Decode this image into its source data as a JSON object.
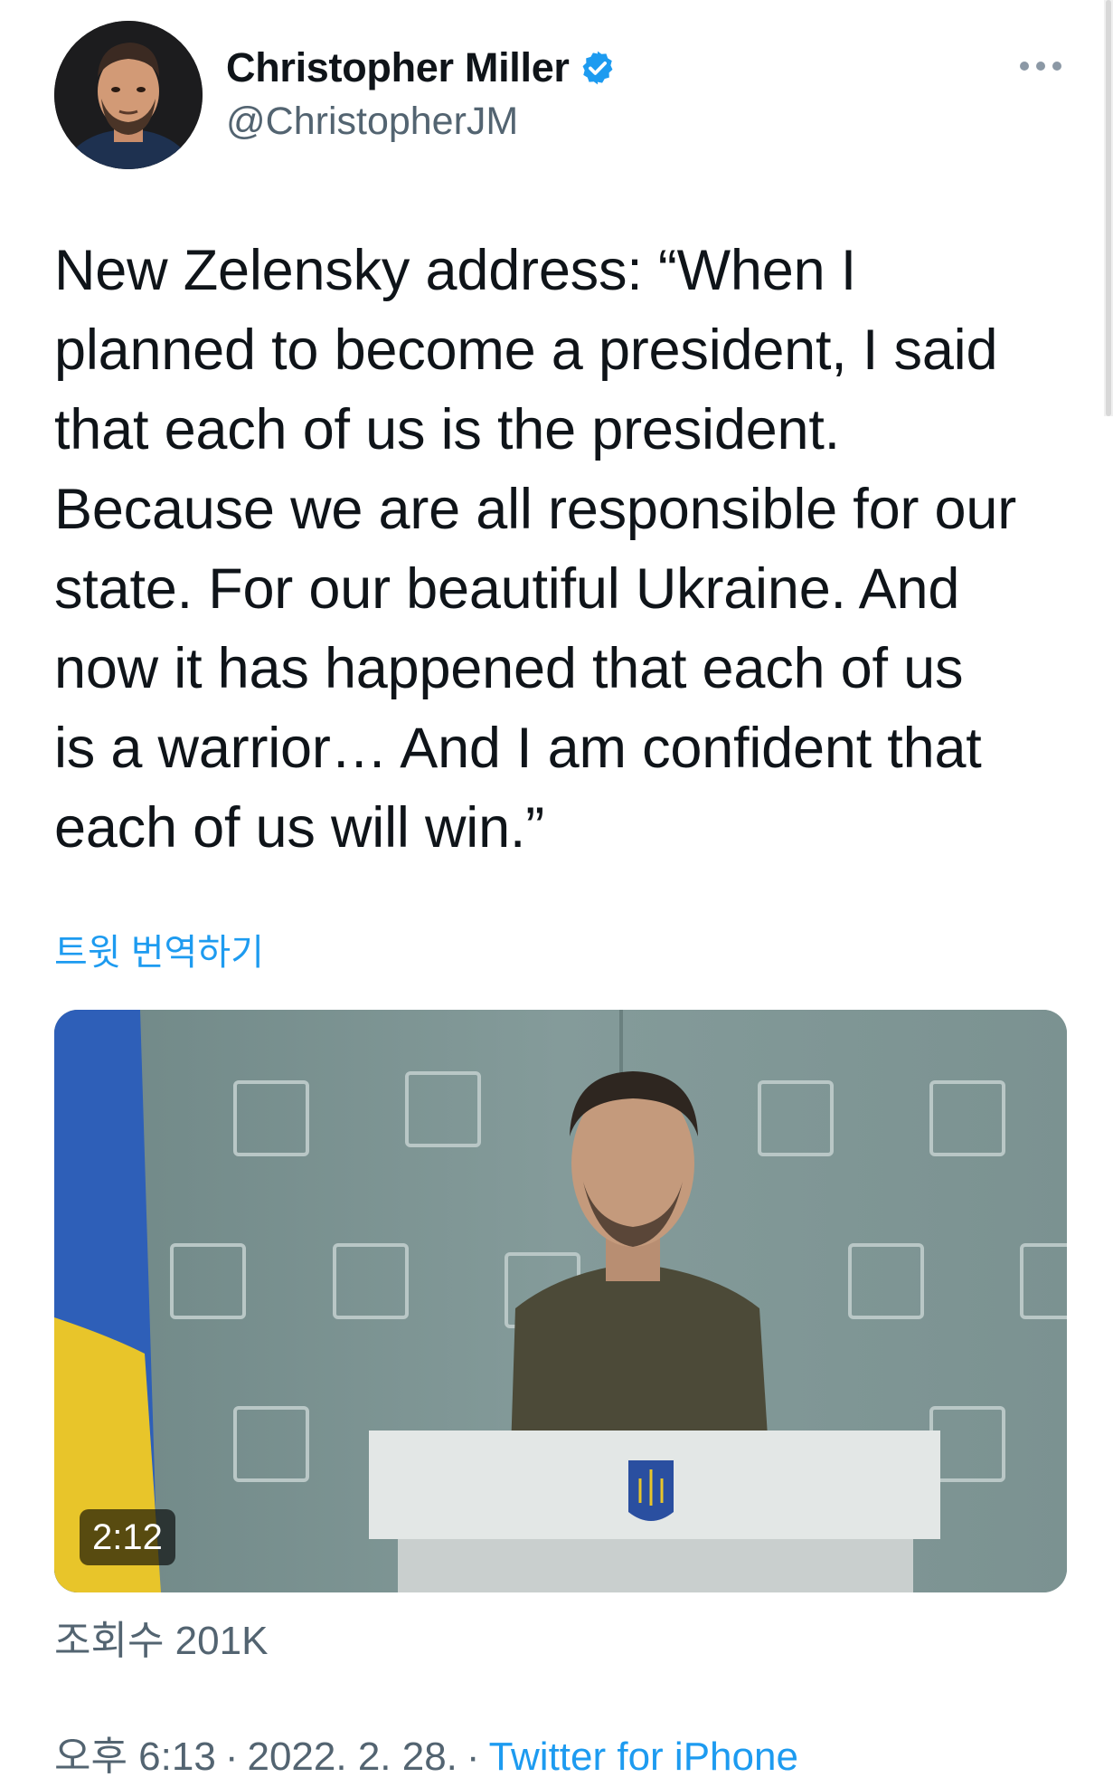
{
  "author": {
    "display_name": "Christopher Miller",
    "handle": "@ChristopherJM",
    "verified": true,
    "avatar_icon": "profile-photo"
  },
  "menu": {
    "more_icon": "more-horizontal-icon"
  },
  "tweet": {
    "text": "New Zelensky address: “When I\nplanned to become a president, I said\nthat each of us is the president.\nBecause we are all responsible for our\nstate. For our beautiful Ukraine. And\nnow it has happened that each of us\nis a warrior… And I am confident that\neach of us will win.”",
    "translate_label": "트윗 번역하기"
  },
  "media": {
    "type": "video",
    "duration": "2:12"
  },
  "stats": {
    "views": "조회수 201K"
  },
  "meta": {
    "time": "오후 6:13",
    "separator": "·",
    "date": "2022. 2. 28.",
    "source": "Twitter for iPhone"
  },
  "colors": {
    "link": "#1d9bf0",
    "secondary_text": "#536471",
    "verified": "#1d9bf0"
  }
}
